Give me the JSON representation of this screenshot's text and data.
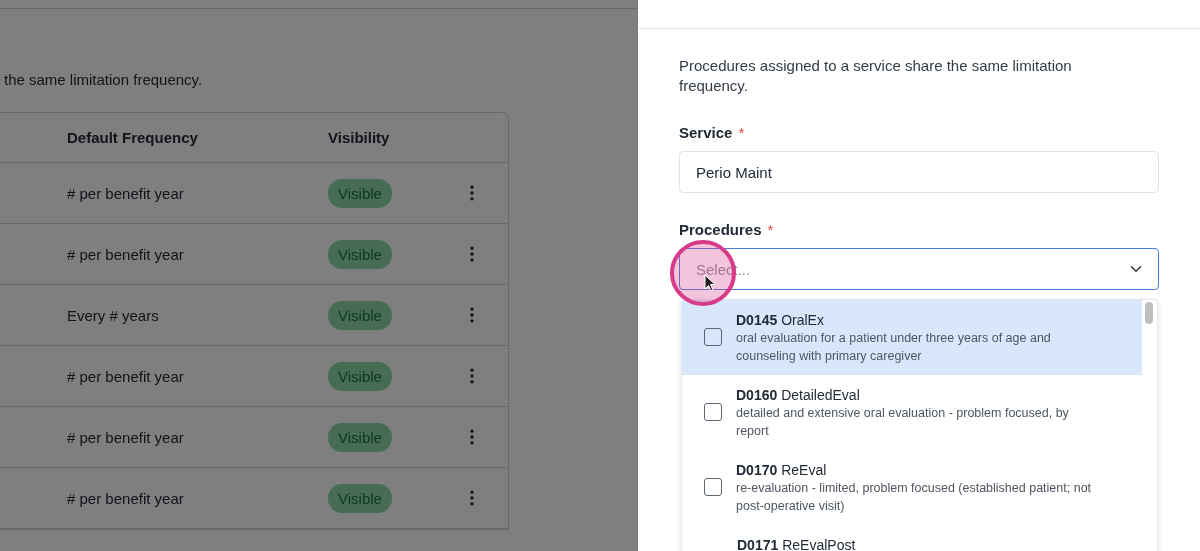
{
  "background_page": {
    "description": "the same limitation frequency.",
    "table": {
      "columns": [
        "Default Frequency",
        "Visibility"
      ],
      "rows": [
        {
          "frequency": "# per benefit year",
          "visibility": "Visible"
        },
        {
          "frequency": "# per benefit year",
          "visibility": "Visible"
        },
        {
          "frequency": "Every # years",
          "visibility": "Visible"
        },
        {
          "frequency": "# per benefit year",
          "visibility": "Visible"
        },
        {
          "frequency": "# per benefit year",
          "visibility": "Visible"
        },
        {
          "frequency": "# per benefit year",
          "visibility": "Visible"
        }
      ]
    }
  },
  "drawer": {
    "description": "Procedures assigned to a service share the same limitation frequency.",
    "service": {
      "label": "Service",
      "required_mark": "*",
      "value": "Perio Maint"
    },
    "procedures": {
      "label": "Procedures",
      "required_mark": "*",
      "placeholder": "Select...",
      "options": [
        {
          "code": "D0145",
          "name": "OralEx",
          "description": "oral evaluation for a patient under three years of age and counseling with primary caregiver",
          "checked": false,
          "highlighted": true
        },
        {
          "code": "D0160",
          "name": "DetailedEval",
          "description": "detailed and extensive oral evaluation - problem focused, by report",
          "checked": false,
          "highlighted": false
        },
        {
          "code": "D0170",
          "name": "ReEval",
          "description": "re-evaluation - limited, problem focused (established patient; not post-operative visit)",
          "checked": false,
          "highlighted": false
        },
        {
          "code": "D0171",
          "name": "ReEvalPost",
          "highlighted": false
        }
      ]
    }
  }
}
